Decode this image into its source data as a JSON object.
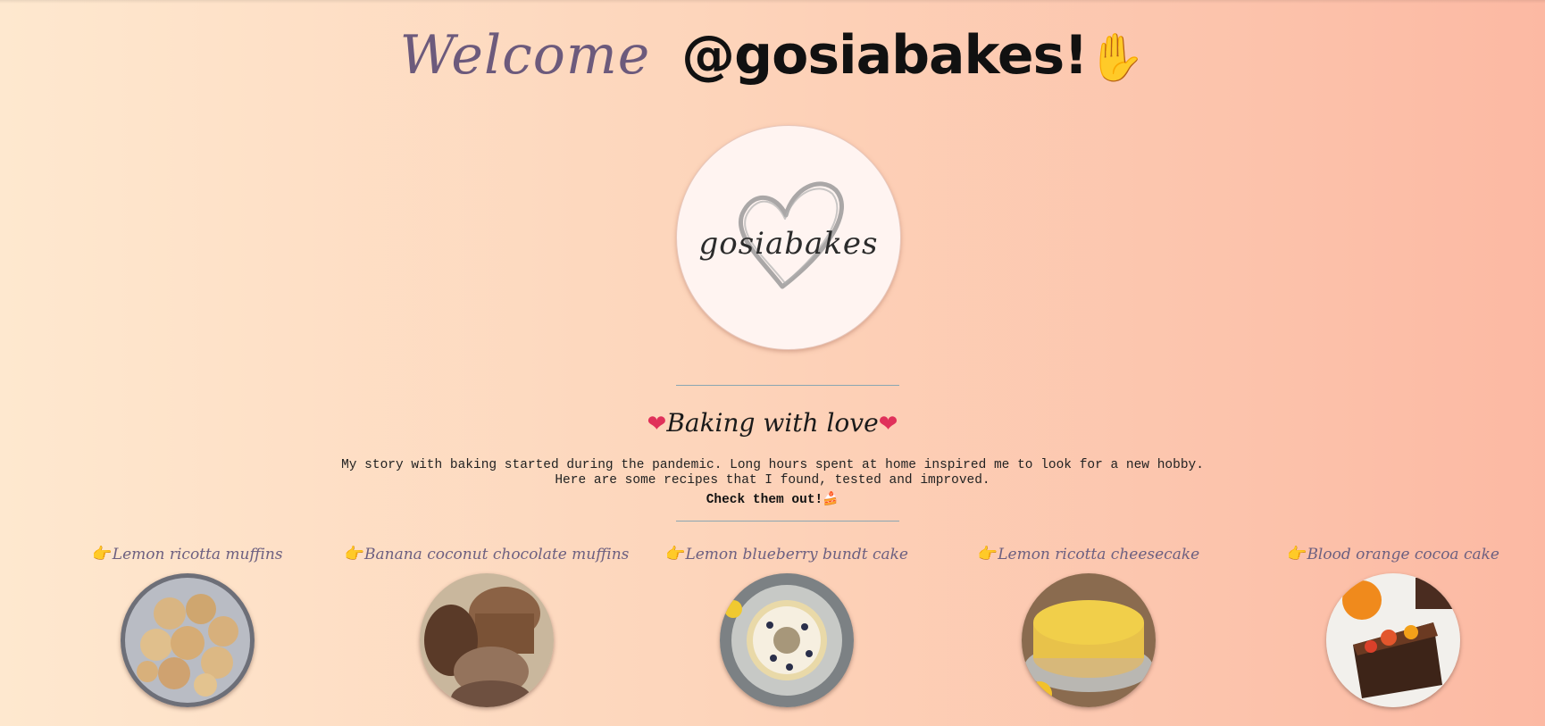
{
  "header": {
    "welcome": "Welcome",
    "handle": "@gosiabakes!",
    "wave_emoji": "✋"
  },
  "logo": {
    "text": "gosiabakes",
    "icon": "heart-logo-icon"
  },
  "intro": {
    "title_left_icon": "❤",
    "title": "Baking with love",
    "title_right_icon": "❤",
    "story_line1": "My story with baking started during the pandemic. Long hours spent at home inspired me to look for a new hobby.",
    "story_line2": "Here are some recipes that I found, tested and improved.",
    "cta": "Check them out!",
    "cta_emoji": "🍰"
  },
  "recipes": [
    {
      "label": "Lemon ricotta muffins",
      "pointer": "👉",
      "image": "muffins-photo"
    },
    {
      "label": "Banana coconut chocolate muffins",
      "pointer": "👉",
      "image": "chocolate-muffins-photo"
    },
    {
      "label": "Lemon blueberry bundt cake",
      "pointer": "👉",
      "image": "bundt-cake-photo"
    },
    {
      "label": "Lemon ricotta cheesecake",
      "pointer": "👉",
      "image": "cheesecake-photo"
    },
    {
      "label": "Blood orange cocoa cake",
      "pointer": "👉",
      "image": "cocoa-cake-photo"
    }
  ],
  "colors": {
    "accent_purple": "#6c5a7c",
    "gradient_left": "#fee8cf",
    "gradient_right": "#fcb9a3",
    "divider": "#8aa6b2"
  }
}
